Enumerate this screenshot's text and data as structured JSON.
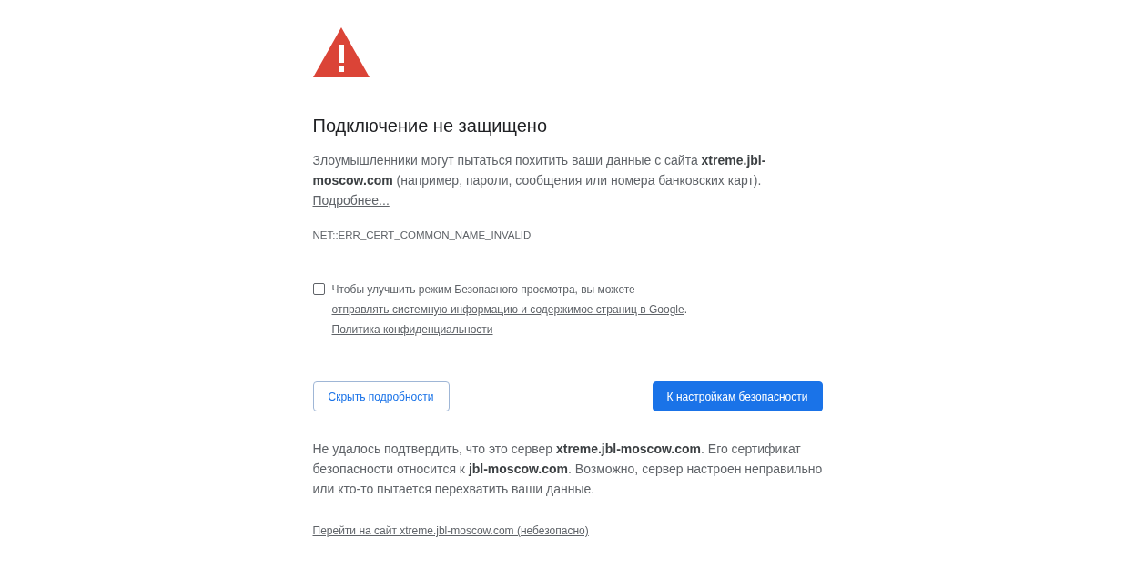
{
  "title": "Подключение не защищено",
  "description": "Злоумышленники могут пытаться похитить ваши данные с сайта **xtreme.jbl-moscow.com** (например, пароли, сообщения или номера банковских карт).",
  "more_link": "Подробнее...",
  "error_code": "NET::ERR_CERT_COMMON_NAME_INVALID",
  "checkbox": {
    "checked": false,
    "text_before": "Чтобы улучшить режим Безопасного просмотра, вы можете",
    "link_1": "отправлять системную информацию и содержимое страниц в Google",
    "text_between": ".",
    "link_2": "Политика конфиденциальности"
  },
  "buttons": [
    {
      "label": "Скрыть подробности",
      "kind": "secondary"
    },
    {
      "label": "К настройкам безопасности",
      "kind": "primary"
    }
  ],
  "details": {
    "text": "Не удалось подтвердить, что это сервер **xtreme.jbl-moscow.com**. Его сертификат безопасности относится к **jbl-moscow.com**. Возможно, сервер настроен неправильно или кто-то пытается перехватить ваши данные.",
    "proceed_link": "Перейти на сайт xtreme.jbl-moscow.com (небезопасно)"
  }
}
